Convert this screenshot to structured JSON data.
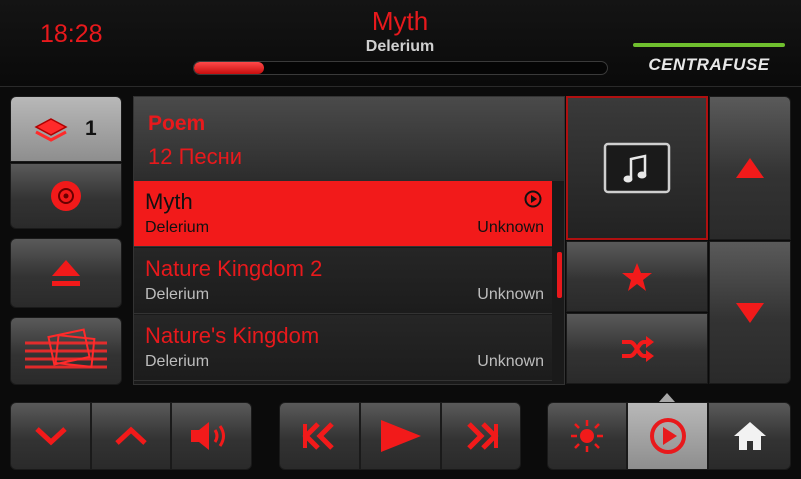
{
  "header": {
    "clock": "18:28",
    "now_playing_title": "Myth",
    "now_playing_artist": "Delerium",
    "progress_fraction": 0.17,
    "logo_text": "CENTRAFUSE"
  },
  "left_panel": {
    "layers_count": "1"
  },
  "list": {
    "album": "Poem",
    "count_text": "12 Песни",
    "items": [
      {
        "title": "Myth",
        "artist": "Delerium",
        "duration": "Unknown",
        "selected": true
      },
      {
        "title": "Nature Kingdom 2",
        "artist": "Delerium",
        "duration": "Unknown",
        "selected": false
      },
      {
        "title": "Nature's Kingdom",
        "artist": "Delerium",
        "duration": "Unknown",
        "selected": false
      }
    ],
    "scroll_fraction": 0.45
  },
  "colors": {
    "accent": "#e8191c",
    "selected_row": "#f21a1a",
    "logo_bar": "#6fbf2e"
  },
  "icons": {
    "left": [
      "layers-icon",
      "disc-icon",
      "eject-icon",
      "cards-icon"
    ],
    "right": [
      "music-note-icon",
      "arrow-up-icon",
      "star-icon",
      "arrow-down-icon",
      "shuffle-icon"
    ],
    "bottom": [
      "chevron-down-icon",
      "chevron-up-icon",
      "volume-icon",
      "previous-icon",
      "play-icon",
      "next-icon",
      "brightness-icon",
      "now-playing-icon",
      "home-icon"
    ]
  }
}
